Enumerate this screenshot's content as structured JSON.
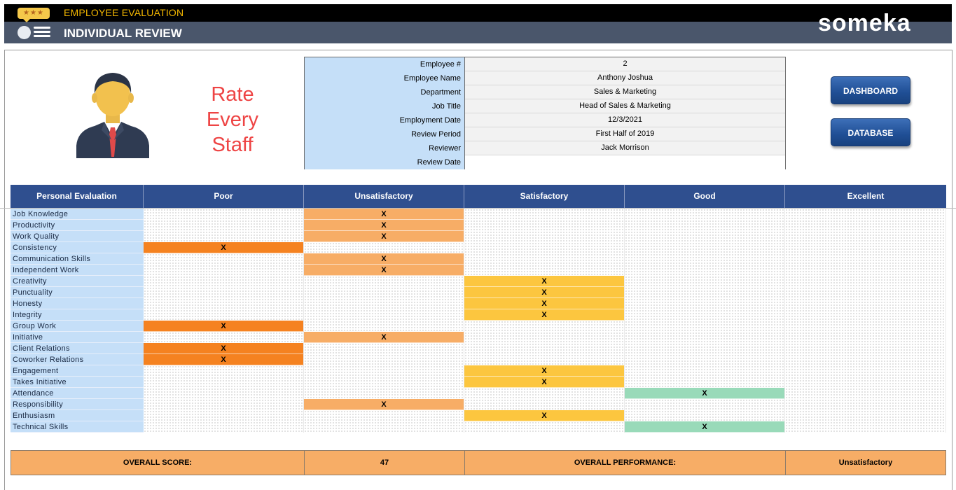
{
  "header": {
    "app_title": "EMPLOYEE EVALUATION",
    "page_title": "INDIVIDUAL REVIEW",
    "brand": "someka",
    "stars": "★★★",
    "colors": {
      "top_bar": "#000000",
      "sub_bar": "#4a566b",
      "app_title": "#f5b800"
    }
  },
  "slogan": {
    "line1": "Rate",
    "line2": "Every",
    "line3": "Staff"
  },
  "employee_info": [
    {
      "label": "Employee #",
      "value": "2"
    },
    {
      "label": "Employee Name",
      "value": "Anthony Joshua"
    },
    {
      "label": "Department",
      "value": "Sales & Marketing"
    },
    {
      "label": "Job Title",
      "value": "Head of Sales & Marketing"
    },
    {
      "label": "Employment Date",
      "value": "12/3/2021"
    },
    {
      "label": "Review Period",
      "value": "First Half of 2019"
    },
    {
      "label": "Reviewer",
      "value": "Jack Morrison"
    },
    {
      "label": "Review Date",
      "value": ""
    }
  ],
  "buttons": {
    "dashboard": "DASHBOARD",
    "database": "DATABASE"
  },
  "evaluation": {
    "columns": [
      "Personal Evaluation",
      "Poor",
      "Unsatisfactory",
      "Satisfactory",
      "Good",
      "Excellent"
    ],
    "mark": "X",
    "level_colors": [
      "#f58220",
      "#f7ad66",
      "#fcc63f",
      "#99dab9",
      "#8fd0a8"
    ],
    "criteria": [
      {
        "name": "Job Knowledge",
        "rating": 1
      },
      {
        "name": "Productivity",
        "rating": 1
      },
      {
        "name": "Work Quality",
        "rating": 1
      },
      {
        "name": "Consistency",
        "rating": 0
      },
      {
        "name": "Communication Skills",
        "rating": 1
      },
      {
        "name": "Independent Work",
        "rating": 1
      },
      {
        "name": "Creativity",
        "rating": 2
      },
      {
        "name": "Punctuality",
        "rating": 2
      },
      {
        "name": "Honesty",
        "rating": 2
      },
      {
        "name": "Integrity",
        "rating": 2
      },
      {
        "name": "Group Work",
        "rating": 0
      },
      {
        "name": "Initiative",
        "rating": 1
      },
      {
        "name": "Client Relations",
        "rating": 0
      },
      {
        "name": "Coworker Relations",
        "rating": 0
      },
      {
        "name": "Engagement",
        "rating": 2
      },
      {
        "name": "Takes Initiative",
        "rating": 2
      },
      {
        "name": "Attendance",
        "rating": 3
      },
      {
        "name": "Responsibility",
        "rating": 1
      },
      {
        "name": "Enthusiasm",
        "rating": 2
      },
      {
        "name": "Technical Skills",
        "rating": 3
      }
    ]
  },
  "summary": {
    "score_label": "OVERALL SCORE:",
    "score_value": "47",
    "performance_label": "OVERALL PERFORMANCE:",
    "performance_value": "Unsatisfactory"
  }
}
